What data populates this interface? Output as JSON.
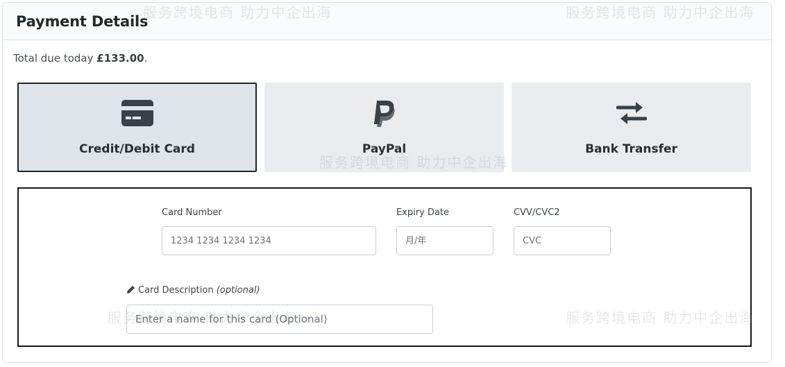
{
  "panel": {
    "title": "Payment Details"
  },
  "total": {
    "prefix": "Total due today",
    "amount": "£133.00",
    "suffix": "."
  },
  "methods": [
    {
      "label": "Credit/Debit Card",
      "icon": "credit-card-icon",
      "selected": true
    },
    {
      "label": "PayPal",
      "icon": "paypal-icon",
      "selected": false
    },
    {
      "label": "Bank Transfer",
      "icon": "exchange-arrows-icon",
      "selected": false
    }
  ],
  "card_form": {
    "card_number_label": "Card Number",
    "card_number_placeholder": "1234 1234 1234 1234",
    "expiry_label": "Expiry Date",
    "expiry_placeholder": "月/年",
    "cvv_label": "CVV/CVC2",
    "cvv_placeholder": "CVC",
    "description_label": "Card Description",
    "description_optional": "(optional)",
    "description_placeholder": "Enter a name for this card (Optional)"
  },
  "watermarks": [
    "服务跨境电商 助力中企出海",
    "服务跨境电商 助力中企出海",
    "服务跨境电商 助力中企出海",
    "服务跨境电商 助力中企出海",
    "服务跨境电商 助力中企出海"
  ],
  "colors": {
    "selected_border": "#1f2328",
    "method_bg": "#e9ebee",
    "selected_bg": "#dfe3ea",
    "icon": "#3a4047"
  }
}
